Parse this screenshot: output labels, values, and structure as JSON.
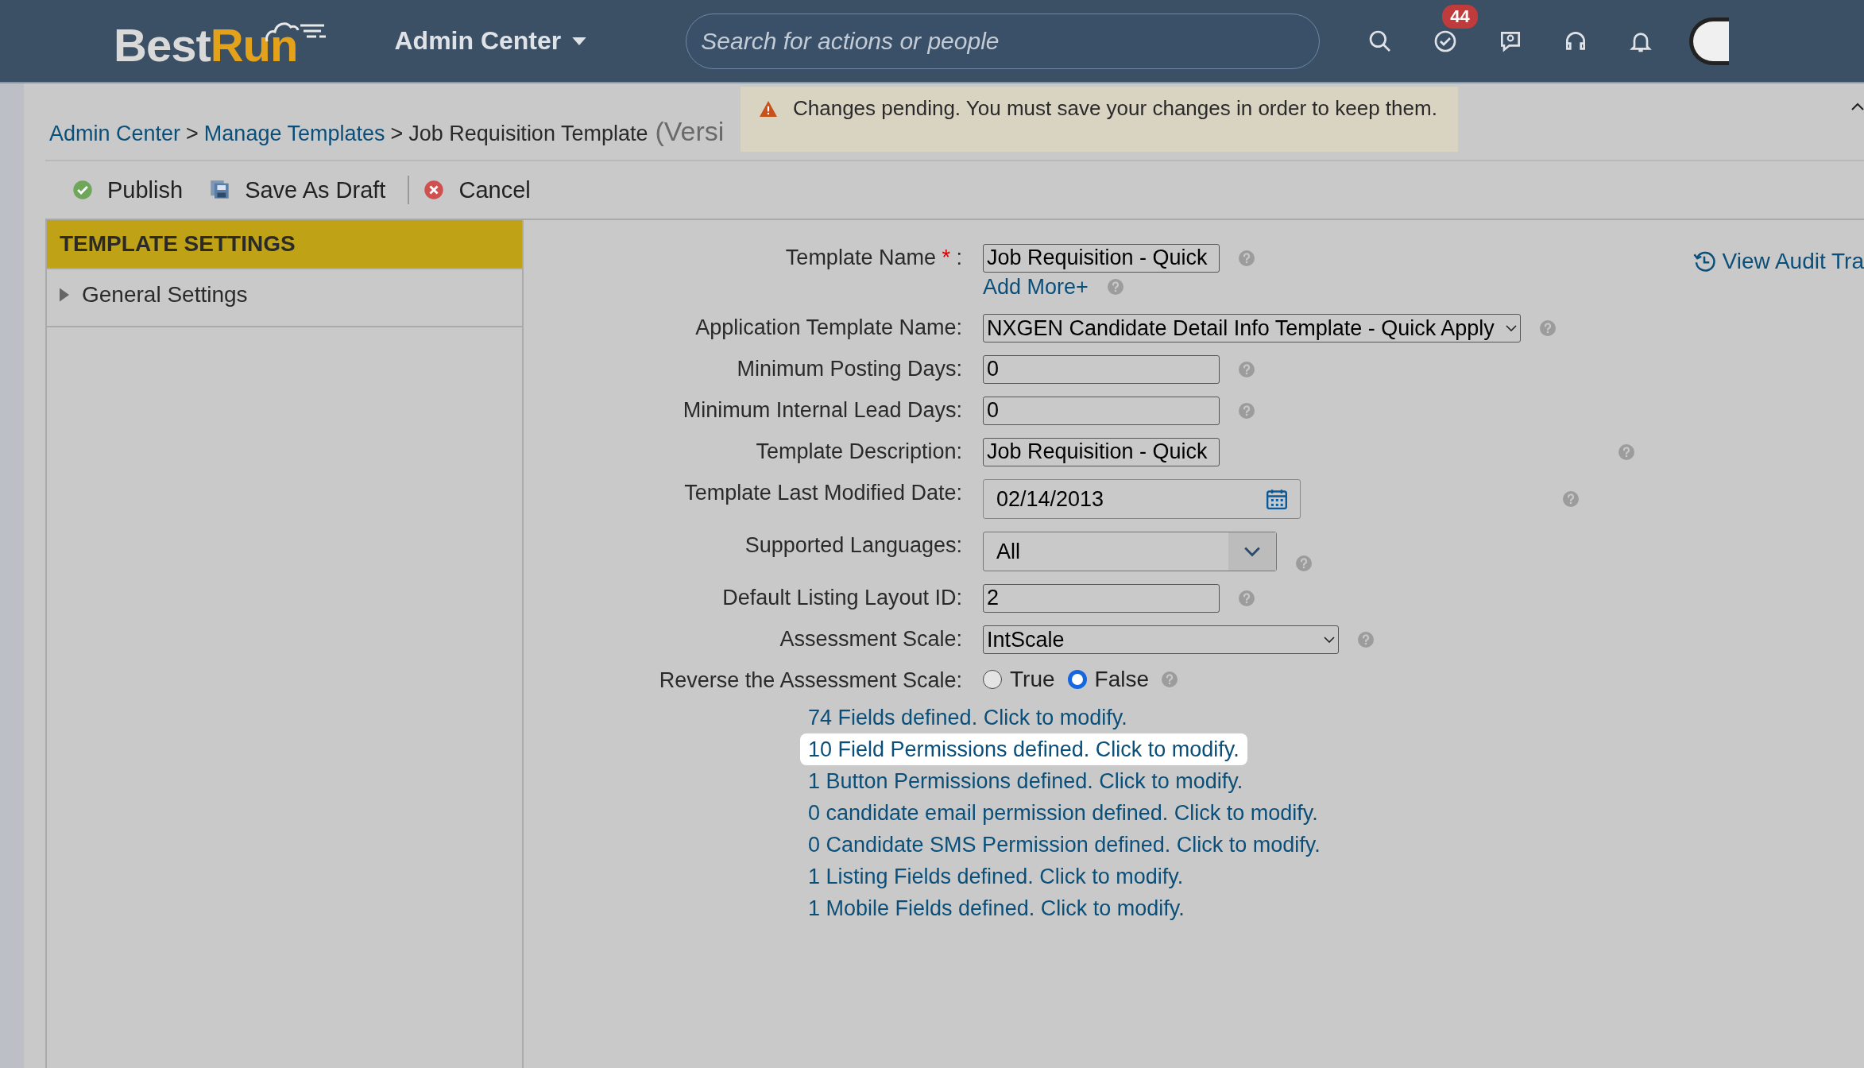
{
  "header": {
    "logo": [
      "Best",
      "Run"
    ],
    "menu": "Admin Center",
    "search": {
      "placeholder": "Search for actions or people"
    },
    "badge": "44"
  },
  "breadcrumb": {
    "links": [
      "Admin Center",
      "Manage Templates"
    ],
    "separator": ">",
    "current": "Job Requisition Template",
    "version": "(Versi"
  },
  "banner": {
    "message": "Changes pending. You must save your changes in order to keep them."
  },
  "toolbar": [
    {
      "kind": "publish",
      "label": "Publish"
    },
    {
      "kind": "draft",
      "label": "Save As Draft"
    },
    {
      "kind": "cancel",
      "label": "Cancel"
    }
  ],
  "sidebar": {
    "title": "TEMPLATE SETTINGS",
    "items": [
      {
        "label": "General Settings",
        "expanded": false
      }
    ]
  },
  "audit_link": "View Audit Tra",
  "fields": [
    {
      "kind": "text",
      "label": "Template Name",
      "required": true,
      "required_mark": "*",
      "label_suffix": ":",
      "value": "Job Requisition - Quick",
      "extra_link": "Add More+"
    },
    {
      "kind": "select",
      "label": "Application Template Name:",
      "value": "NXGEN Candidate Detail Info Template - Quick Apply"
    },
    {
      "kind": "text",
      "label": "Minimum Posting Days:",
      "value": "0"
    },
    {
      "kind": "text",
      "label": "Minimum Internal Lead Days:",
      "value": "0"
    },
    {
      "kind": "text",
      "label": "Template Description:",
      "value": "Job Requisition - Quick"
    },
    {
      "kind": "date",
      "label": "Template Last Modified Date:",
      "value": "02/14/2013"
    },
    {
      "kind": "dropdown",
      "label": "Supported Languages:",
      "value": "All"
    },
    {
      "kind": "text",
      "label": "Default Listing Layout ID:",
      "value": "2"
    },
    {
      "kind": "select",
      "label": "Assessment Scale:",
      "value": "IntScale"
    },
    {
      "kind": "radio",
      "label": "Reverse the Assessment Scale:",
      "options": [
        {
          "label": "True",
          "selected": false
        },
        {
          "label": "False",
          "selected": true
        }
      ]
    }
  ],
  "links": [
    {
      "text": "74 Fields defined. Click to modify.",
      "highlighted": false
    },
    {
      "text": "10 Field Permissions defined. Click to modify.",
      "highlighted": true
    },
    {
      "text": "1 Button Permissions defined. Click to modify.",
      "highlighted": false
    },
    {
      "text": "0 candidate email permission defined. Click to modify.",
      "highlighted": false
    },
    {
      "text": "0 Candidate SMS Permission defined. Click to modify.",
      "highlighted": false
    },
    {
      "text": "1 Listing Fields defined. Click to modify.",
      "highlighted": false
    },
    {
      "text": "1 Mobile Fields defined. Click to modify.",
      "highlighted": false
    }
  ]
}
